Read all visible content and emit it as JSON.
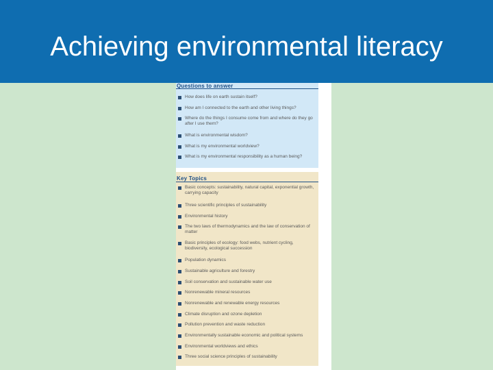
{
  "slide": {
    "title": "Achieving environmental literacy"
  },
  "panel": {
    "questions_heading": "Questions to answer",
    "questions": [
      "How does life on earth sustain itself?",
      "How am I connected to the earth and other living things?",
      "Where do the things I consume come from and where do they go after I use them?",
      "What is environmental wisdom?",
      "What is my environmental worldview?",
      "What is my environmental responsibility as a human being?"
    ],
    "topics_heading": "Key Topics",
    "topics": [
      "Basic concepts: sustainability, natural capital, exponential growth, carrying capacity",
      "Three scientific principles of sustainability",
      "Environmental history",
      "The two laws of thermodynamics and the law of conservation of matter",
      "Basic principles of ecology: food webs, nutrient cycling, biodiversity, ecological succession",
      "Population dynamics",
      "Sustainable agriculture and forestry",
      "Soil conservation and sustainable water use",
      "Nonrenewable mineral resources",
      "Nonrenewable and renewable energy resources",
      "Climate disruption and ozone depletion",
      "Pollution prevention and waste reduction",
      "Environmentally sustainable economic and political systems",
      "Environmental worldviews and ethics",
      "Three social science principles of sustainability"
    ]
  },
  "colors": {
    "title_bar": "#0f6db0",
    "background": "#cde6cd",
    "questions_bg": "#d2e8f7",
    "topics_bg": "#f1e6c8",
    "heading_text": "#1d4f86"
  }
}
